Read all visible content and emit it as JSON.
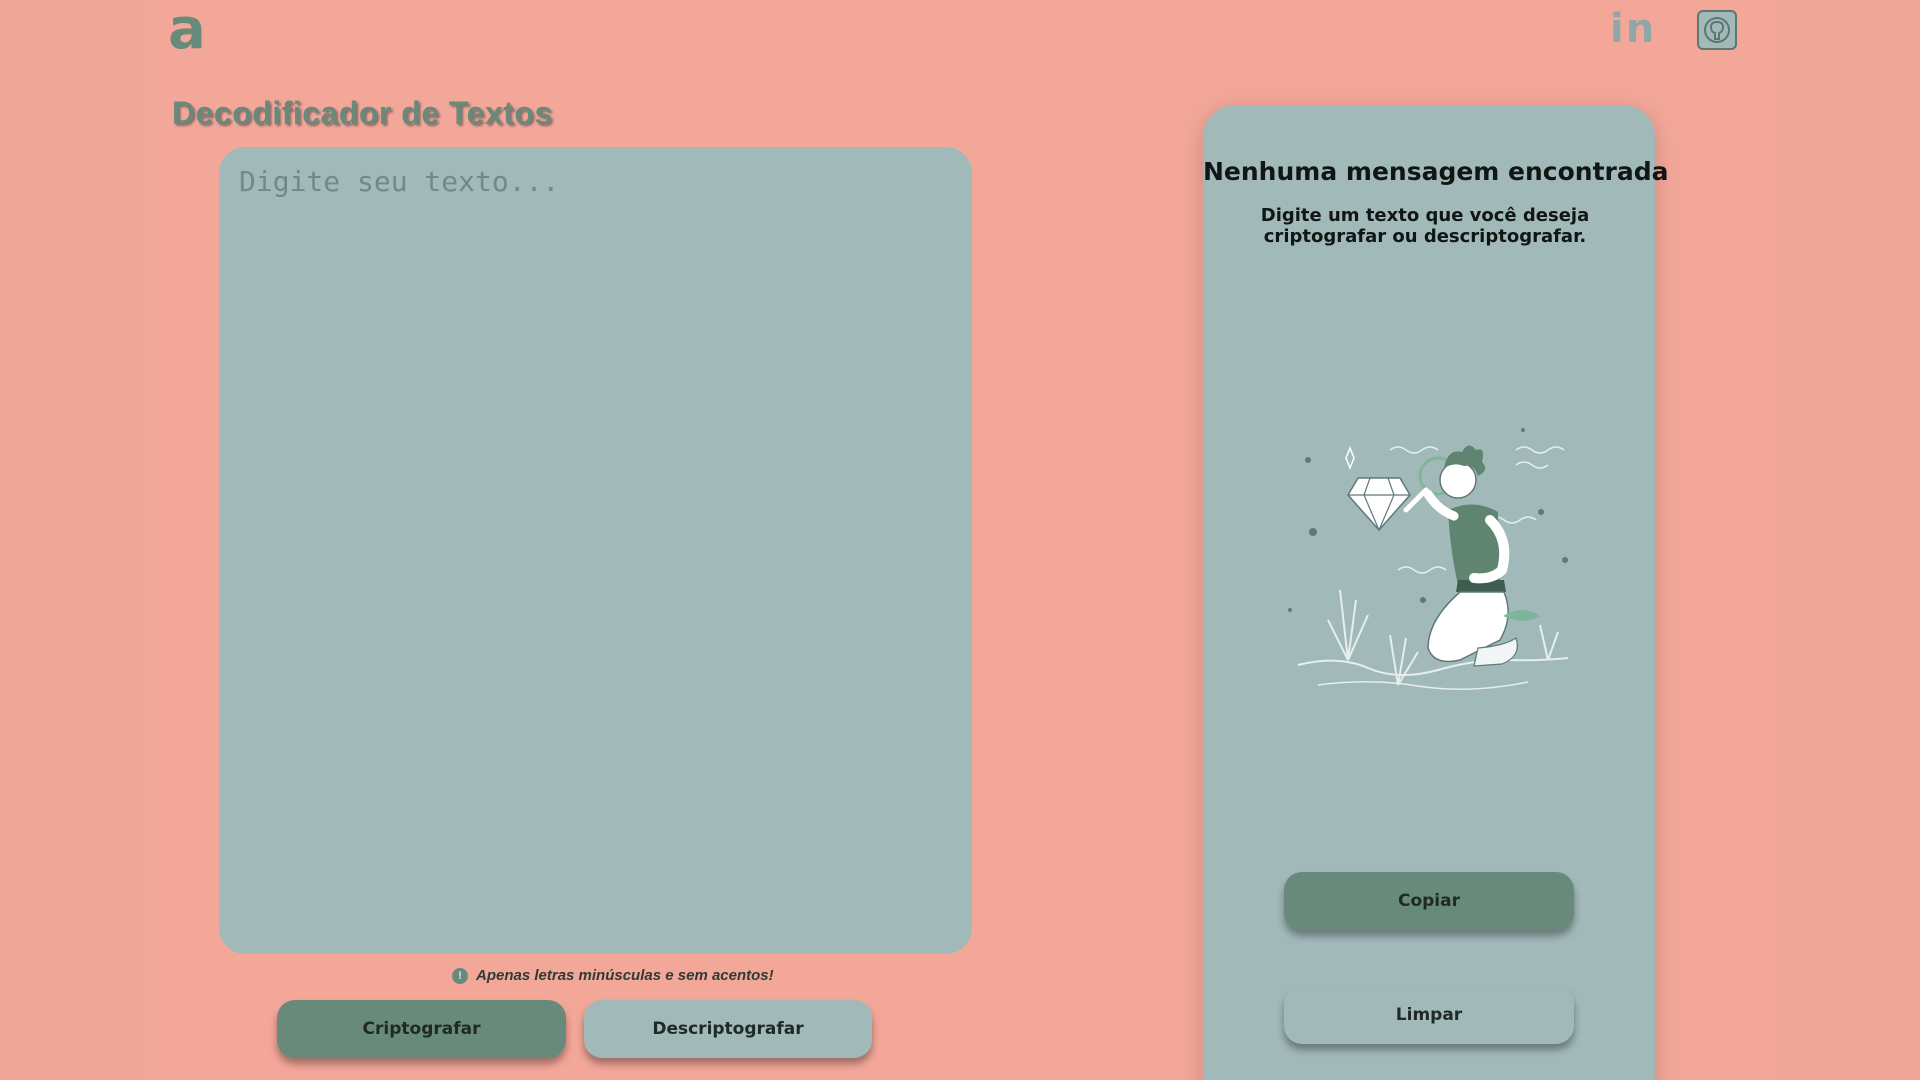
{
  "header": {
    "logo_text": "a",
    "linkedin_text": "in",
    "icons": [
      "linkedin-icon",
      "github-icon"
    ]
  },
  "main": {
    "title": "Decodificador de Textos",
    "input_placeholder": "Digite seu texto...",
    "input_value": "",
    "hint": "Apenas letras minúsculas e sem acentos!",
    "hint_icon": "!",
    "encrypt_button": "Criptografar",
    "decrypt_button": "Descriptografar"
  },
  "output": {
    "title": "Nenhuma mensagem encontrada",
    "description": "Digite um texto que você deseja criptografar ou descriptografar.",
    "illustration": "person-searching-diamond-illustration",
    "copy_button": "Copiar",
    "clear_button": "Limpar"
  },
  "colors": {
    "background": "#f3a799",
    "panel": "#a2b9ba",
    "accent": "#688a7b",
    "text_dark": "#0f1614"
  }
}
